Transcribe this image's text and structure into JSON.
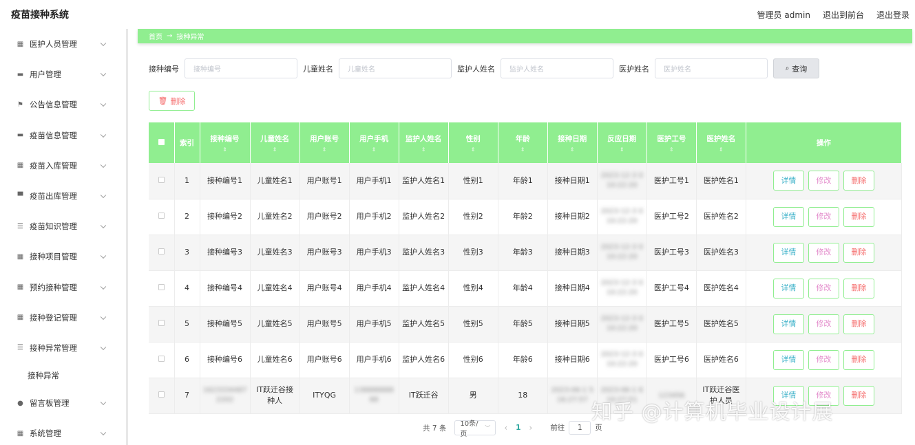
{
  "app": {
    "title": "疫苗接种系统"
  },
  "header": {
    "admin_label": "管理员 admin",
    "to_front": "退出到前台",
    "logout": "退出登录"
  },
  "sidebar": {
    "items": [
      {
        "label": "医护人员管理",
        "icon": "grid-icon"
      },
      {
        "label": "用户管理",
        "icon": "briefcase-icon"
      },
      {
        "label": "公告信息管理",
        "icon": "flag-icon"
      },
      {
        "label": "疫苗信息管理",
        "icon": "briefcase-icon"
      },
      {
        "label": "疫苗入库管理",
        "icon": "grid-icon"
      },
      {
        "label": "疫苗出库管理",
        "icon": "monitor-icon"
      },
      {
        "label": "疫苗知识管理",
        "icon": "list-icon"
      },
      {
        "label": "接种项目管理",
        "icon": "grid-icon"
      },
      {
        "label": "预约接种管理",
        "icon": "grid-icon"
      },
      {
        "label": "接种登记管理",
        "icon": "grid-icon"
      },
      {
        "label": "接种异常管理",
        "icon": "list-icon"
      }
    ],
    "sub_item": "接种异常",
    "items_after": [
      {
        "label": "留言板管理",
        "icon": "balloon-icon"
      },
      {
        "label": "系统管理",
        "icon": "grid-icon"
      }
    ]
  },
  "breadcrumb": {
    "home": "首页",
    "sep": "→",
    "current": "接种异常"
  },
  "search": {
    "fields": [
      {
        "label": "接种编号",
        "placeholder": "接种编号"
      },
      {
        "label": "儿童姓名",
        "placeholder": "儿童姓名"
      },
      {
        "label": "监护人姓名",
        "placeholder": "监护人姓名"
      },
      {
        "label": "医护姓名",
        "placeholder": "医护姓名"
      }
    ],
    "query_label": "查询"
  },
  "toolbar": {
    "delete_label": "删除"
  },
  "table": {
    "columns": [
      "索引",
      "接种编号",
      "儿童姓名",
      "用户账号",
      "用户手机",
      "监护人姓名",
      "性别",
      "年龄",
      "接种日期",
      "反应日期",
      "医护工号",
      "医护姓名",
      "操作"
    ],
    "rows": [
      {
        "idx": "1",
        "code": "接种编号1",
        "child": "儿童姓名1",
        "account": "用户账号1",
        "phone": "用户手机1",
        "guardian": "监护人姓名1",
        "gender": "性别1",
        "age": "年龄1",
        "date": "接种日期1",
        "react": "2023-12-3 0 10:22:20",
        "staff_no": "医护工号1",
        "staff": "医护姓名1"
      },
      {
        "idx": "2",
        "code": "接种编号2",
        "child": "儿童姓名2",
        "account": "用户账号2",
        "phone": "用户手机2",
        "guardian": "监护人姓名2",
        "gender": "性别2",
        "age": "年龄2",
        "date": "接种日期2",
        "react": "2023-12-3 0 10:22:20",
        "staff_no": "医护工号2",
        "staff": "医护姓名2"
      },
      {
        "idx": "3",
        "code": "接种编号3",
        "child": "儿童姓名3",
        "account": "用户账号3",
        "phone": "用户手机3",
        "guardian": "监护人姓名3",
        "gender": "性别3",
        "age": "年龄3",
        "date": "接种日期3",
        "react": "2023-12-3 0 10:22:20",
        "staff_no": "医护工号3",
        "staff": "医护姓名3"
      },
      {
        "idx": "4",
        "code": "接种编号4",
        "child": "儿童姓名4",
        "account": "用户账号4",
        "phone": "用户手机4",
        "guardian": "监护人姓名4",
        "gender": "性别4",
        "age": "年龄4",
        "date": "接种日期4",
        "react": "2023-12-3 0 10:22:20",
        "staff_no": "医护工号4",
        "staff": "医护姓名4"
      },
      {
        "idx": "5",
        "code": "接种编号5",
        "child": "儿童姓名5",
        "account": "用户账号5",
        "phone": "用户手机5",
        "guardian": "监护人姓名5",
        "gender": "性别5",
        "age": "年龄5",
        "date": "接种日期5",
        "react": "2023-12-3 0 10:22:20",
        "staff_no": "医护工号5",
        "staff": "医护姓名5"
      },
      {
        "idx": "6",
        "code": "接种编号6",
        "child": "儿童姓名6",
        "account": "用户账号6",
        "phone": "用户手机6",
        "guardian": "监护人姓名6",
        "gender": "性别6",
        "age": "年龄6",
        "date": "接种日期6",
        "react": "2023-12-3 0 10:22:20",
        "staff_no": "医护工号6",
        "staff": "医护姓名6"
      },
      {
        "idx": "7",
        "code": "1623334487 2202",
        "child": "IT跃迁谷接种人",
        "account": "ITYQG",
        "phone": "138888888 88",
        "guardian": "IT跃迁谷",
        "gender": "男",
        "age": "18",
        "date": "2023-06-1 5 16:27:57",
        "react": "2023-06-1 6 10:27:51",
        "staff_no": "123456",
        "staff": "IT跃迁谷医护人员"
      }
    ],
    "ops": {
      "detail": "详情",
      "edit": "修改",
      "del": "删除"
    }
  },
  "pagination": {
    "total": "共 7 条",
    "page_size": "10条/页",
    "current": "1",
    "goto_prefix": "前往",
    "goto_value": "1",
    "goto_suffix": "页"
  },
  "watermark": "知乎 @计算机毕业设计展"
}
